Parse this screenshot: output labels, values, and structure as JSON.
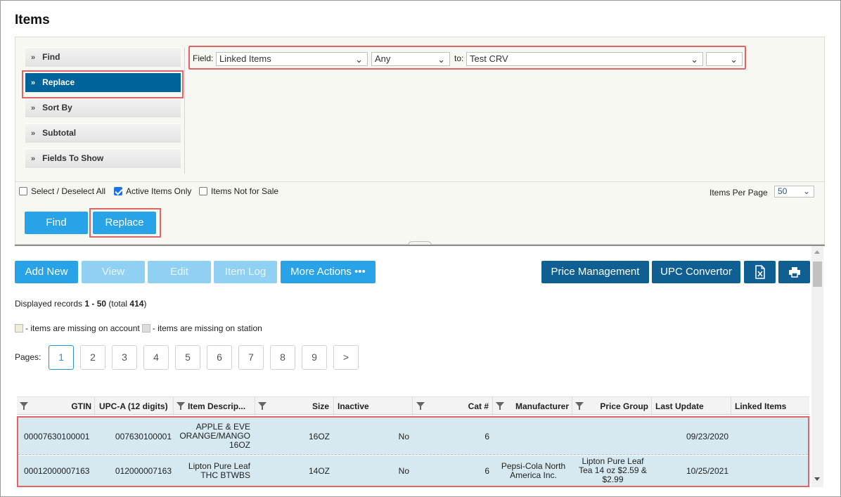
{
  "page": {
    "title": "Items"
  },
  "side_menu": {
    "items": [
      {
        "label": "Find",
        "active": false
      },
      {
        "label": "Replace",
        "active": true
      },
      {
        "label": "Sort By",
        "active": false
      },
      {
        "label": "Subtotal",
        "active": false
      },
      {
        "label": "Fields To Show",
        "active": false
      }
    ],
    "chevron": "»"
  },
  "replace_criteria": {
    "field_label": "Field:",
    "field_value": "Linked Items",
    "operator_value": "Any",
    "to_label": "to:",
    "to_value": "Test CRV",
    "extra_value": ""
  },
  "options": {
    "select_all_label": "Select / Deselect All",
    "select_all_checked": false,
    "active_only_label": "Active Items Only",
    "active_only_checked": true,
    "not_for_sale_label": "Items Not for Sale",
    "not_for_sale_checked": false,
    "items_per_page_label": "Items Per Page",
    "items_per_page_value": "50"
  },
  "actions": {
    "find_label": "Find",
    "replace_label": "Replace"
  },
  "toolbar": {
    "add_new": "Add New",
    "view": "View",
    "edit": "Edit",
    "item_log": "Item Log",
    "more_actions": "More Actions •••",
    "price_management": "Price Management",
    "upc_convertor": "UPC Convertor",
    "excel_icon": "excel-export-icon",
    "print_icon": "print-icon"
  },
  "records": {
    "prefix": "Displayed records ",
    "range": "1 - 50",
    "total_prefix": " (total ",
    "total": "414",
    "suffix": ")"
  },
  "legend": {
    "account_label": " - items are missing on account",
    "account_color": "#eeeed6",
    "station_label": " - items are missing on station",
    "station_color": "#dddddd"
  },
  "pagination": {
    "label": "Pages:",
    "pages": [
      "1",
      "2",
      "3",
      "4",
      "5",
      "6",
      "7",
      "8",
      "9",
      ">"
    ],
    "current": "1"
  },
  "table": {
    "columns": [
      "GTIN",
      "UPC-A (12 digits)",
      "Item Descrip...",
      "Size",
      "Inactive",
      "Cat #",
      "Manufacturer",
      "Price Group",
      "Last Update",
      "Linked Items"
    ],
    "rows": [
      {
        "gtin": "00007630100001",
        "upc": "007630100001",
        "desc": [
          "APPLE & EVE",
          "ORANGE/MANGO",
          "16OZ"
        ],
        "size": "16OZ",
        "inactive": "No",
        "cat": "6",
        "manufacturer": [
          "",
          ""
        ],
        "price_group": [
          "",
          "",
          ""
        ],
        "last_update": "09/23/2020",
        "linked": ""
      },
      {
        "gtin": "00012000007163",
        "upc": "012000007163",
        "desc": [
          "Lipton Pure Leaf",
          "THC BTWBS",
          ""
        ],
        "size": "14OZ",
        "inactive": "No",
        "cat": "6",
        "manufacturer": [
          "Pepsi-Cola North",
          "America Inc."
        ],
        "price_group": [
          "Lipton Pure Leaf",
          "Tea 14 oz $2.59 &",
          "$2.99"
        ],
        "last_update": "10/25/2021",
        "linked": ""
      }
    ]
  },
  "colors": {
    "accent": "#29a3e8",
    "dark_button": "#0f5f92",
    "active_menu": "#00649b",
    "highlight": "#e06666",
    "row_bg": "#d6e8f0"
  }
}
